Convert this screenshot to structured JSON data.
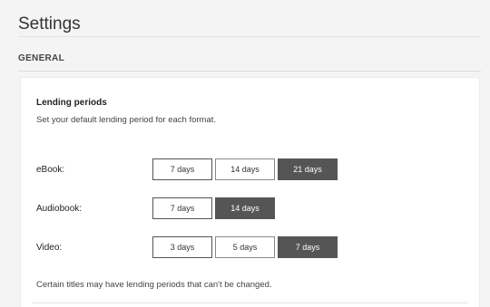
{
  "page": {
    "title": "Settings",
    "section": "GENERAL"
  },
  "lending": {
    "heading": "Lending periods",
    "description": "Set your default lending period for each format.",
    "note": "Certain titles may have lending periods that can't be changed.",
    "rows": [
      {
        "label": "eBook:",
        "options": [
          "7 days",
          "14 days",
          "21 days"
        ],
        "selected": "21 days"
      },
      {
        "label": "Audiobook:",
        "options": [
          "7 days",
          "14 days"
        ],
        "selected": "14 days"
      },
      {
        "label": "Video:",
        "options": [
          "3 days",
          "5 days",
          "7 days"
        ],
        "selected": "7 days"
      }
    ]
  },
  "colors": {
    "selected_bg": "#555555",
    "page_bg": "#f4f4f4"
  }
}
